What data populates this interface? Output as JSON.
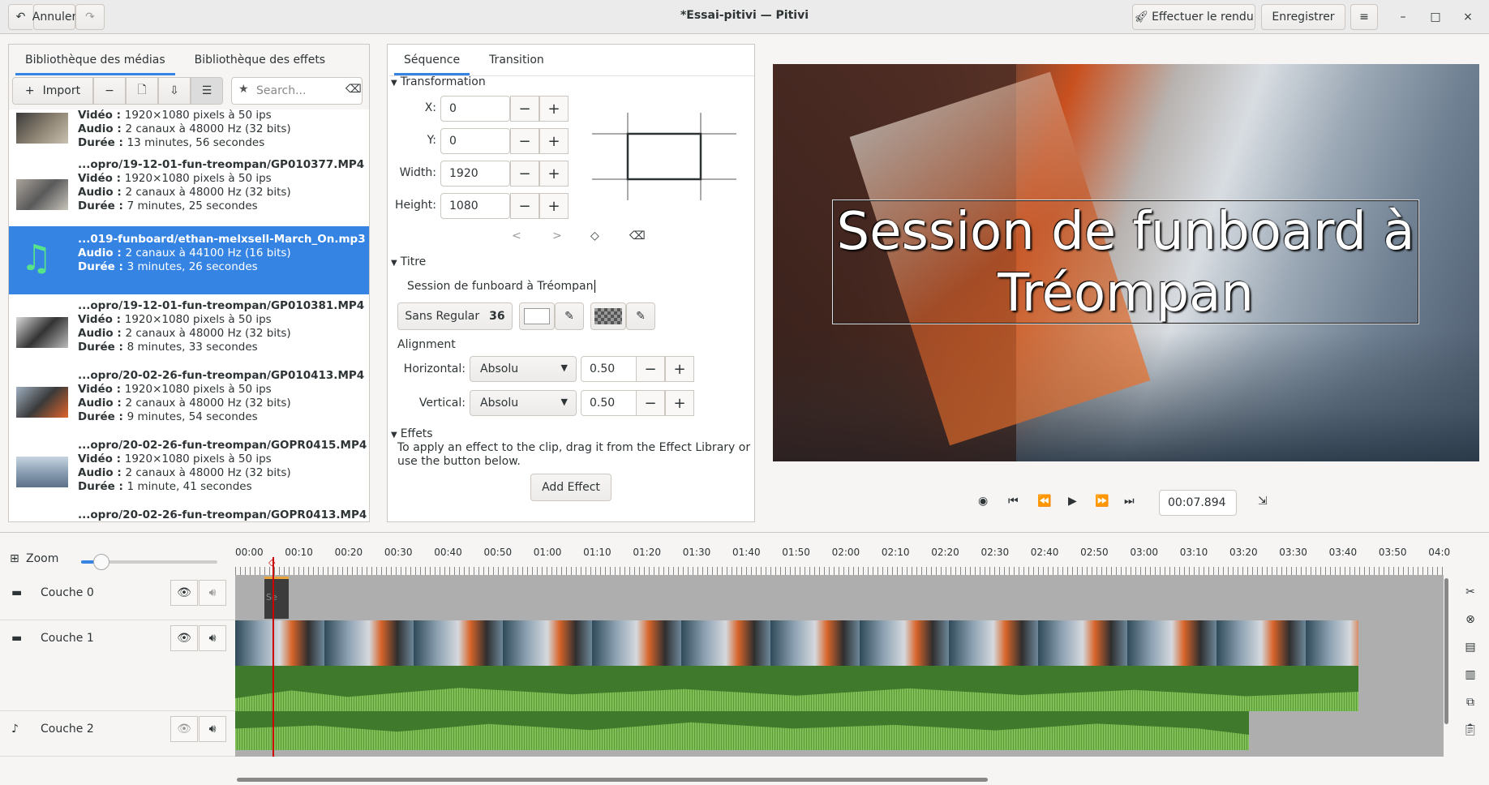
{
  "header": {
    "undo_label": "Annuler",
    "redo_icon": "redo-icon",
    "title": "*Essai-pitivi — Pitivi",
    "render_label": "Effectuer le rendu",
    "save_label": "Enregistrer",
    "menu_icon": "hamburger-menu-icon",
    "minimize": "–",
    "maximize": "□",
    "close": "×"
  },
  "library": {
    "tabs": [
      "Bibliothèque des médias",
      "Bibliothèque des effets"
    ],
    "import_label": "Import",
    "search_placeholder": "Search...",
    "items": [
      {
        "name": "",
        "l1": "Vidéo : ",
        "l1v": "1920×1080 pixels à 50 ips",
        "l2": "Audio : ",
        "l2v": "2 canaux à 48000 Hz (32 bits)",
        "l3": "Durée : ",
        "l3v": "13 minutes, 56 secondes"
      },
      {
        "name": "...opro/19-12-01-fun-treompan/GP010377.MP4",
        "l1": "Vidéo : ",
        "l1v": "1920×1080 pixels à 50 ips",
        "l2": "Audio : ",
        "l2v": "2 canaux à 48000 Hz (32 bits)",
        "l3": "Durée : ",
        "l3v": "7 minutes, 25 secondes"
      },
      {
        "name": "...019-funboard/ethan-melxsell-March_On.mp3",
        "l1": "Audio : ",
        "l1v": "2 canaux à 44100 Hz (16 bits)",
        "l2": "Durée : ",
        "l2v": "3 minutes, 26 secondes"
      },
      {
        "name": "...opro/19-12-01-fun-treompan/GP010381.MP4",
        "l1": "Vidéo : ",
        "l1v": "1920×1080 pixels à 50 ips",
        "l2": "Audio : ",
        "l2v": "2 canaux à 48000 Hz (32 bits)",
        "l3": "Durée : ",
        "l3v": "8 minutes, 33 secondes"
      },
      {
        "name": "...opro/20-02-26-fun-treompan/GP010413.MP4",
        "l1": "Vidéo : ",
        "l1v": "1920×1080 pixels à 50 ips",
        "l2": "Audio : ",
        "l2v": "2 canaux à 48000 Hz (32 bits)",
        "l3": "Durée : ",
        "l3v": "9 minutes, 54 secondes"
      },
      {
        "name": "...opro/20-02-26-fun-treompan/GOPR0415.MP4",
        "l1": "Vidéo : ",
        "l1v": "1920×1080 pixels à 50 ips",
        "l2": "Audio : ",
        "l2v": "2 canaux à 48000 Hz (32 bits)",
        "l3": "Durée : ",
        "l3v": "1 minute, 41 secondes"
      },
      {
        "name": "...opro/20-02-26-fun-treompan/GOPR0413.MP4"
      }
    ]
  },
  "props": {
    "tabs": [
      "Séquence",
      "Transition"
    ],
    "transformation_label": "Transformation",
    "x_label": "X:",
    "x_value": "0",
    "y_label": "Y:",
    "y_value": "0",
    "width_label": "Width:",
    "width_value": "1920",
    "height_label": "Height:",
    "height_value": "1080",
    "titre_label": "Titre",
    "title_text": "Session de funboard à Tréompan",
    "font_label": "Sans Regular",
    "font_size": "36",
    "alignment_label": "Alignment",
    "horizontal_label": "Horizontal:",
    "horizontal_mode": "Absolu",
    "horizontal_value": "0.50",
    "vertical_label": "Vertical:",
    "vertical_mode": "Absolu",
    "vertical_value": "0.50",
    "effects_label": "Effets",
    "effects_help": "To apply an effect to the clip, drag it from the Effect Library or use the button below.",
    "add_effect_label": "Add Effect",
    "minus": "−",
    "plus": "+"
  },
  "viewer": {
    "overlay_line1": "Session de funboard à",
    "overlay_line2": "Tréompan",
    "timecode": "00:07.894"
  },
  "timeline": {
    "zoom_label": "Zoom",
    "zoom_level": 0.15,
    "ruler": [
      "00:00",
      "00:10",
      "00:20",
      "00:30",
      "00:40",
      "00:50",
      "01:00",
      "01:10",
      "01:20",
      "01:30",
      "01:40",
      "01:50",
      "02:00",
      "02:10",
      "02:20",
      "02:30",
      "02:40",
      "02:50",
      "03:00",
      "03:10",
      "03:20",
      "03:30",
      "03:40",
      "03:50",
      "04:0"
    ],
    "layers": [
      "Couche 0",
      "Couche 1",
      "Couche 2"
    ],
    "title_clip_text": "Se"
  },
  "colors": {
    "accent": "#3584e4",
    "audio_dark": "#3f7a2c",
    "audio_light": "#7fbf55",
    "playhead": "#cc0000"
  }
}
